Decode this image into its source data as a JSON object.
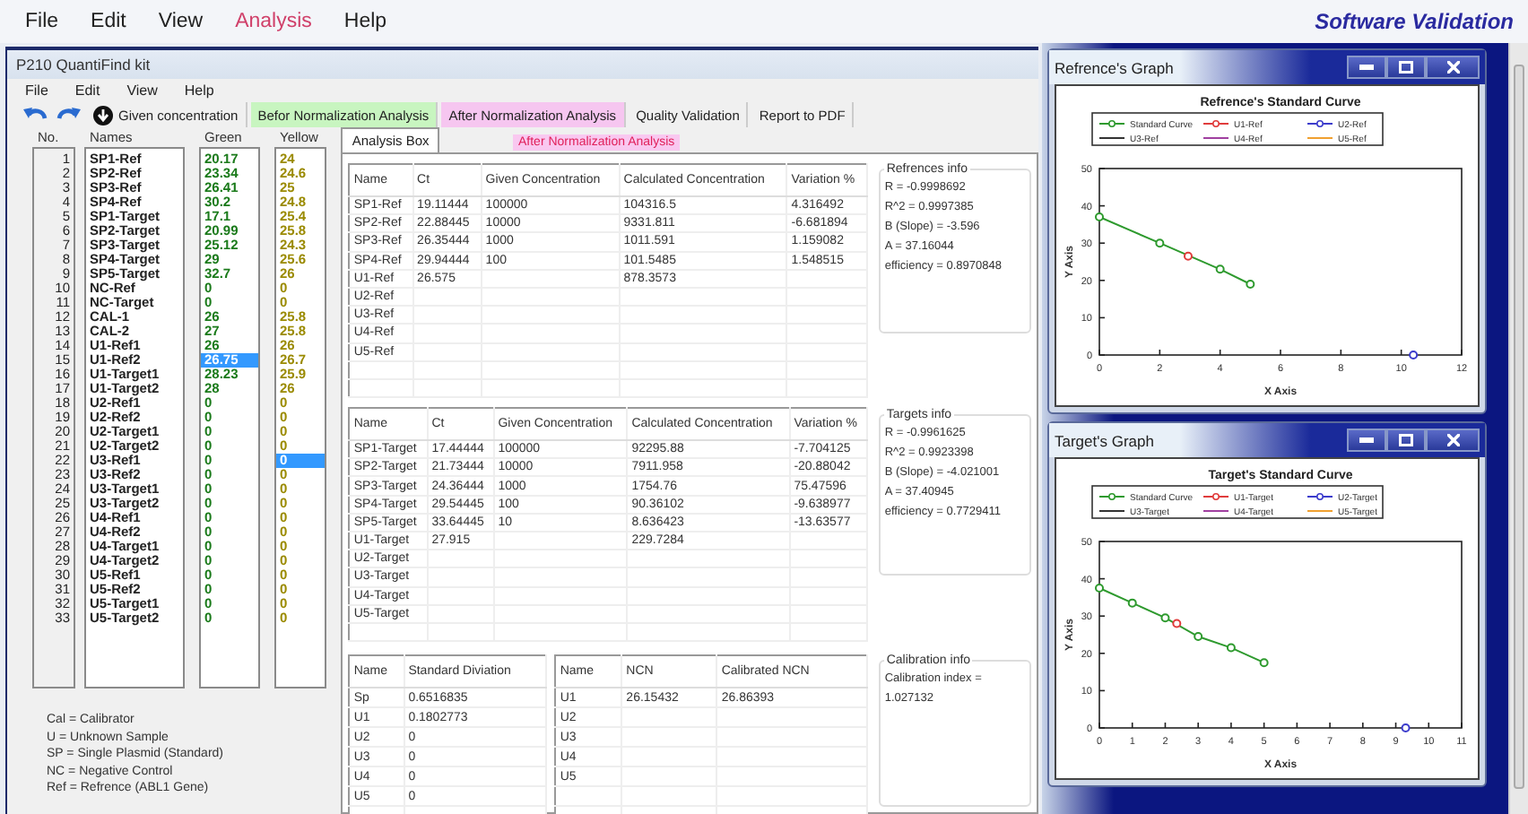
{
  "menu": [
    {
      "label": "File",
      "selected": false
    },
    {
      "label": "Edit",
      "selected": false
    },
    {
      "label": "View",
      "selected": false
    },
    {
      "label": "Analysis",
      "selected": true
    },
    {
      "label": "Help",
      "selected": false
    }
  ],
  "brand": "Software Validation",
  "main_window": {
    "title": "P210 QuantiFind kit",
    "menu": [
      "File",
      "Edit",
      "View",
      "Help"
    ],
    "toolbar": [
      {
        "kind": "undo"
      },
      {
        "kind": "redo"
      },
      {
        "kind": "download",
        "label": "Given concentration"
      },
      {
        "kind": "active",
        "label": "Befor Normalization Analysis"
      },
      {
        "kind": "hover",
        "label": "After Normalization Analysis"
      },
      {
        "kind": "plain",
        "label": "Quality Validation"
      },
      {
        "kind": "plain",
        "label": "Report to PDF"
      }
    ],
    "tooltip": "After Normalization Analysis"
  },
  "list_headers": [
    "No.",
    "Names",
    "Green",
    "Yellow"
  ],
  "samples": [
    {
      "no": "1",
      "name": "SP1-Ref",
      "green": {
        "value": "20.17",
        "selected": false
      },
      "yellow": {
        "value": "24",
        "selected": false
      }
    },
    {
      "no": "2",
      "name": "SP2-Ref",
      "green": {
        "value": "23.34",
        "selected": false
      },
      "yellow": {
        "value": "24.6",
        "selected": false
      }
    },
    {
      "no": "3",
      "name": "SP3-Ref",
      "green": {
        "value": "26.41",
        "selected": false
      },
      "yellow": {
        "value": "25",
        "selected": false
      }
    },
    {
      "no": "4",
      "name": "SP4-Ref",
      "green": {
        "value": "30.2",
        "selected": false
      },
      "yellow": {
        "value": "24.8",
        "selected": false
      }
    },
    {
      "no": "5",
      "name": "SP1-Target",
      "green": {
        "value": "17.1",
        "selected": false
      },
      "yellow": {
        "value": "25.4",
        "selected": false
      }
    },
    {
      "no": "6",
      "name": "SP2-Target",
      "green": {
        "value": "20.99",
        "selected": false
      },
      "yellow": {
        "value": "25.8",
        "selected": false
      }
    },
    {
      "no": "7",
      "name": "SP3-Target",
      "green": {
        "value": "25.12",
        "selected": false
      },
      "yellow": {
        "value": "24.3",
        "selected": false
      }
    },
    {
      "no": "8",
      "name": "SP4-Target",
      "green": {
        "value": "29",
        "selected": false
      },
      "yellow": {
        "value": "25.6",
        "selected": false
      }
    },
    {
      "no": "9",
      "name": "SP5-Target",
      "green": {
        "value": "32.7",
        "selected": false
      },
      "yellow": {
        "value": "26",
        "selected": false
      }
    },
    {
      "no": "10",
      "name": "NC-Ref",
      "green": {
        "value": "0",
        "selected": false
      },
      "yellow": {
        "value": "0",
        "selected": false
      }
    },
    {
      "no": "11",
      "name": "NC-Target",
      "green": {
        "value": "0",
        "selected": false
      },
      "yellow": {
        "value": "0",
        "selected": false
      }
    },
    {
      "no": "12",
      "name": "CAL-1",
      "green": {
        "value": "26",
        "selected": false
      },
      "yellow": {
        "value": "25.8",
        "selected": false
      }
    },
    {
      "no": "13",
      "name": "CAL-2",
      "green": {
        "value": "27",
        "selected": false
      },
      "yellow": {
        "value": "25.8",
        "selected": false
      }
    },
    {
      "no": "14",
      "name": "U1-Ref1",
      "green": {
        "value": "26",
        "selected": false
      },
      "yellow": {
        "value": "26",
        "selected": false
      }
    },
    {
      "no": "15",
      "name": "U1-Ref2",
      "green": {
        "value": "26.75",
        "selected": true
      },
      "yellow": {
        "value": "26.7",
        "selected": false
      }
    },
    {
      "no": "16",
      "name": "U1-Target1",
      "green": {
        "value": "28.23",
        "selected": false
      },
      "yellow": {
        "value": "25.9",
        "selected": false
      }
    },
    {
      "no": "17",
      "name": "U1-Target2",
      "green": {
        "value": "28",
        "selected": false
      },
      "yellow": {
        "value": "26",
        "selected": false
      }
    },
    {
      "no": "18",
      "name": "U2-Ref1",
      "green": {
        "value": "0",
        "selected": false
      },
      "yellow": {
        "value": "0",
        "selected": false
      }
    },
    {
      "no": "19",
      "name": "U2-Ref2",
      "green": {
        "value": "0",
        "selected": false
      },
      "yellow": {
        "value": "0",
        "selected": false
      }
    },
    {
      "no": "20",
      "name": "U2-Target1",
      "green": {
        "value": "0",
        "selected": false
      },
      "yellow": {
        "value": "0",
        "selected": false
      }
    },
    {
      "no": "21",
      "name": "U2-Target2",
      "green": {
        "value": "0",
        "selected": false
      },
      "yellow": {
        "value": "0",
        "selected": false
      }
    },
    {
      "no": "22",
      "name": "U3-Ref1",
      "green": {
        "value": "0",
        "selected": false
      },
      "yellow": {
        "value": "0",
        "selected": true
      }
    },
    {
      "no": "23",
      "name": "U3-Ref2",
      "green": {
        "value": "0",
        "selected": false
      },
      "yellow": {
        "value": "0",
        "selected": false
      }
    },
    {
      "no": "24",
      "name": "U3-Target1",
      "green": {
        "value": "0",
        "selected": false
      },
      "yellow": {
        "value": "0",
        "selected": false
      }
    },
    {
      "no": "25",
      "name": "U3-Target2",
      "green": {
        "value": "0",
        "selected": false
      },
      "yellow": {
        "value": "0",
        "selected": false
      }
    },
    {
      "no": "26",
      "name": "U4-Ref1",
      "green": {
        "value": "0",
        "selected": false
      },
      "yellow": {
        "value": "0",
        "selected": false
      }
    },
    {
      "no": "27",
      "name": "U4-Ref2",
      "green": {
        "value": "0",
        "selected": false
      },
      "yellow": {
        "value": "0",
        "selected": false
      }
    },
    {
      "no": "28",
      "name": "U4-Target1",
      "green": {
        "value": "0",
        "selected": false
      },
      "yellow": {
        "value": "0",
        "selected": false
      }
    },
    {
      "no": "29",
      "name": "U4-Target2",
      "green": {
        "value": "0",
        "selected": false
      },
      "yellow": {
        "value": "0",
        "selected": false
      }
    },
    {
      "no": "30",
      "name": "U5-Ref1",
      "green": {
        "value": "0",
        "selected": false
      },
      "yellow": {
        "value": "0",
        "selected": false
      }
    },
    {
      "no": "31",
      "name": "U5-Ref2",
      "green": {
        "value": "0",
        "selected": false
      },
      "yellow": {
        "value": "0",
        "selected": false
      }
    },
    {
      "no": "32",
      "name": "U5-Target1",
      "green": {
        "value": "0",
        "selected": false
      },
      "yellow": {
        "value": "0",
        "selected": false
      }
    },
    {
      "no": "33",
      "name": "U5-Target2",
      "green": {
        "value": "0",
        "selected": false
      },
      "yellow": {
        "value": "0",
        "selected": false
      }
    }
  ],
  "notes": [
    "Cal = Calibrator",
    "U = Unknown Sample",
    "SP = Single Plasmid (Standard)",
    "NC = Negative Control",
    "Ref = Refrence (ABL1 Gene)"
  ],
  "tabs": [
    {
      "label": "Analysis Box",
      "selected": true
    }
  ],
  "ref_table": {
    "columns": [
      "Name",
      "Ct",
      "Given Concentration",
      "Calculated Concentration",
      "Variation %"
    ],
    "rows": [
      [
        "SP1-Ref",
        "19.11444",
        "100000",
        "104316.5",
        "4.316492"
      ],
      [
        "SP2-Ref",
        "22.88445",
        "10000",
        "9331.811",
        "-6.681894"
      ],
      [
        "SP3-Ref",
        "26.35444",
        "1000",
        "1011.591",
        "1.159082"
      ],
      [
        "SP4-Ref",
        "29.94444",
        "100",
        "101.5485",
        "1.548515"
      ],
      [
        "U1-Ref",
        "26.575",
        null,
        "878.3573",
        null
      ],
      [
        "U2-Ref",
        null,
        null,
        null,
        null
      ],
      [
        "U3-Ref",
        null,
        null,
        null,
        null
      ],
      [
        "U4-Ref",
        null,
        null,
        null,
        null
      ],
      [
        "U5-Ref",
        null,
        null,
        null,
        null
      ]
    ]
  },
  "target_table": {
    "columns": [
      "Name",
      "Ct",
      "Given Concentration",
      "Calculated Concentration",
      "Variation %"
    ],
    "rows": [
      [
        "SP1-Target",
        "17.44444",
        "100000",
        "92295.88",
        "-7.704125"
      ],
      [
        "SP2-Target",
        "21.73444",
        "10000",
        "7911.958",
        "-20.88042"
      ],
      [
        "SP3-Target",
        "24.36444",
        "1000",
        "1754.76",
        "75.47596"
      ],
      [
        "SP4-Target",
        "29.54445",
        "100",
        "90.36102",
        "-9.638977"
      ],
      [
        "SP5-Target",
        "33.64445",
        "10",
        "8.636423",
        "-13.63577"
      ],
      [
        "U1-Target",
        "27.915",
        null,
        "229.7284",
        null
      ],
      [
        "U2-Target",
        null,
        null,
        null,
        null
      ],
      [
        "U3-Target",
        null,
        null,
        null,
        null
      ],
      [
        "U4-Target",
        null,
        null,
        null,
        null
      ],
      [
        "U5-Target",
        null,
        null,
        null,
        null
      ]
    ]
  },
  "deviation_table": {
    "columns": [
      "Name",
      "Standard Diviation"
    ],
    "rows": [
      [
        "Sp",
        "0.6516835"
      ],
      [
        "U1",
        "0.1802773"
      ],
      [
        "U2",
        "0"
      ],
      [
        "U3",
        "0"
      ],
      [
        "U4",
        "0"
      ],
      [
        "U5",
        "0"
      ]
    ]
  },
  "ncn_table": {
    "columns": [
      "Name",
      "NCN",
      "Calibrated NCN"
    ],
    "rows": [
      [
        "U1",
        "26.15432",
        "26.86393"
      ],
      [
        "U2",
        null,
        null
      ],
      [
        "U3",
        null,
        null
      ],
      [
        "U4",
        null,
        null
      ],
      [
        "U5",
        null,
        null
      ]
    ]
  },
  "references_info": {
    "title": "Refrences info",
    "lines": [
      "R = -0.9998692",
      "R^2 = 0.9997385",
      "B (Slope) = -3.596",
      "A = 37.16044",
      "efficiency = 0.8970848"
    ]
  },
  "targets_info": {
    "title": "Targets info",
    "lines": [
      "R = -0.9961625",
      "R^2 = 0.9923398",
      "B (Slope) = -4.021001",
      "A = 37.40945",
      "efficiency = 0.7729411"
    ]
  },
  "calibration_info": {
    "title": "Calibration info",
    "lines": [
      "Calibration index = 1.027132"
    ]
  },
  "graphs": [
    {
      "window_title": "Refrence's Graph",
      "chart_data": {
        "type": "line",
        "title": "Refrence's Standard Curve",
        "xlabel": "X Axis",
        "ylabel": "Y Axis",
        "legend": "top",
        "x": [
          0,
          2,
          2.94,
          3,
          4,
          5,
          10.4
        ],
        "xlim": [
          0,
          12
        ],
        "ylim": [
          0,
          50
        ],
        "xticks": [
          0,
          2,
          4,
          6,
          8,
          10,
          12
        ],
        "yticks": [
          0,
          10,
          20,
          30,
          40,
          50
        ],
        "series": [
          {
            "name": "Standard Curve",
            "color": "#2e9a2e",
            "marker": "circle",
            "values": [
              37,
              30,
              null,
              null,
              23,
              19,
              null
            ]
          },
          {
            "name": "U1-Ref",
            "color": "#e03c3c",
            "marker": "circle",
            "values": [
              null,
              null,
              26.5,
              null,
              null,
              null,
              null
            ]
          },
          {
            "name": "U2-Ref",
            "color": "#3c3ccc",
            "marker": "circle",
            "values": [
              null,
              null,
              null,
              null,
              null,
              null,
              0
            ]
          },
          {
            "name": "U3-Ref",
            "color": "#333333",
            "values": [
              null,
              null,
              null,
              null,
              null,
              null,
              null
            ]
          },
          {
            "name": "U4-Ref",
            "color": "#a040a0",
            "values": [
              null,
              null,
              null,
              null,
              null,
              null,
              null
            ]
          },
          {
            "name": "U5-Ref",
            "color": "#f0a030",
            "values": [
              null,
              null,
              null,
              null,
              null,
              null,
              null
            ]
          }
        ]
      }
    },
    {
      "window_title": "Target's Graph",
      "chart_data": {
        "type": "line",
        "title": "Target's Standard Curve",
        "xlabel": "X Axis",
        "ylabel": "Y Axis",
        "legend": "top",
        "x": [
          0,
          1,
          2,
          2.35,
          3,
          4,
          5,
          9.3
        ],
        "xlim": [
          0,
          11
        ],
        "ylim": [
          0,
          50
        ],
        "xticks": [
          0,
          1,
          2,
          3,
          4,
          5,
          6,
          7,
          8,
          9,
          10,
          11
        ],
        "yticks": [
          0,
          10,
          20,
          30,
          40,
          50
        ],
        "series": [
          {
            "name": "Standard Curve",
            "color": "#2e9a2e",
            "marker": "circle",
            "values": [
              37.5,
              33.5,
              29.5,
              null,
              24.5,
              21.5,
              17.5,
              null
            ]
          },
          {
            "name": "U1-Target",
            "color": "#e03c3c",
            "marker": "circle",
            "values": [
              null,
              null,
              null,
              28,
              null,
              null,
              null,
              null
            ]
          },
          {
            "name": "U2-Target",
            "color": "#3c3ccc",
            "marker": "circle",
            "values": [
              null,
              null,
              null,
              null,
              null,
              null,
              null,
              0
            ]
          },
          {
            "name": "U3-Target",
            "color": "#333333",
            "values": [
              null,
              null,
              null,
              null,
              null,
              null,
              null,
              null
            ]
          },
          {
            "name": "U4-Target",
            "color": "#a040a0",
            "values": [
              null,
              null,
              null,
              null,
              null,
              null,
              null,
              null
            ]
          },
          {
            "name": "U5-Target",
            "color": "#f0a030",
            "values": [
              null,
              null,
              null,
              null,
              null,
              null,
              null,
              null
            ]
          }
        ]
      }
    }
  ]
}
